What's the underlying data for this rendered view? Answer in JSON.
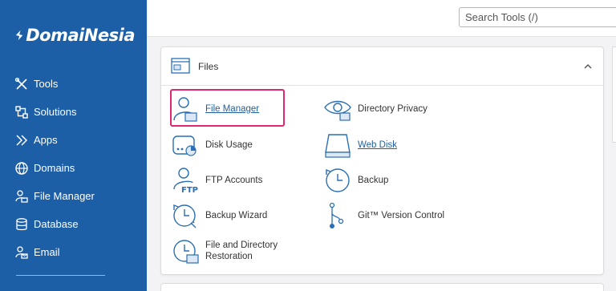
{
  "brand": {
    "name": "DomaiNesia"
  },
  "sidebar": {
    "items": [
      {
        "label": "Tools",
        "icon": "tools-icon"
      },
      {
        "label": "Solutions",
        "icon": "solutions-icon"
      },
      {
        "label": "Apps",
        "icon": "apps-icon"
      },
      {
        "label": "Domains",
        "icon": "globe-icon"
      },
      {
        "label": "File Manager",
        "icon": "file-manager-icon"
      },
      {
        "label": "Database",
        "icon": "database-icon"
      },
      {
        "label": "Email",
        "icon": "email-icon"
      }
    ]
  },
  "search": {
    "placeholder": "Search Tools (/)"
  },
  "files_panel": {
    "title": "Files",
    "tools": [
      {
        "label": "File Manager",
        "icon": "file-manager-icon",
        "link": true,
        "highlighted": true
      },
      {
        "label": "Directory Privacy",
        "icon": "eye-icon",
        "link": false
      },
      {
        "label": "Disk Usage",
        "icon": "disk-usage-icon",
        "link": false
      },
      {
        "label": "Web Disk",
        "icon": "web-disk-icon",
        "link": true
      },
      {
        "label": "FTP Accounts",
        "icon": "ftp-icon",
        "link": false
      },
      {
        "label": "Backup",
        "icon": "backup-icon",
        "link": false
      },
      {
        "label": "Backup Wizard",
        "icon": "backup-wizard-icon",
        "link": false
      },
      {
        "label": "Git™ Version Control",
        "icon": "git-icon",
        "link": false
      },
      {
        "label": "File and Directory",
        "label_line2": "Restoration",
        "icon": "restore-icon",
        "link": false
      }
    ]
  },
  "colors": {
    "sidebar_bg": "#1d5fa6",
    "highlight": "#e0286e",
    "link": "#1f5f9e",
    "icon_blue": "#2a6fb5"
  }
}
